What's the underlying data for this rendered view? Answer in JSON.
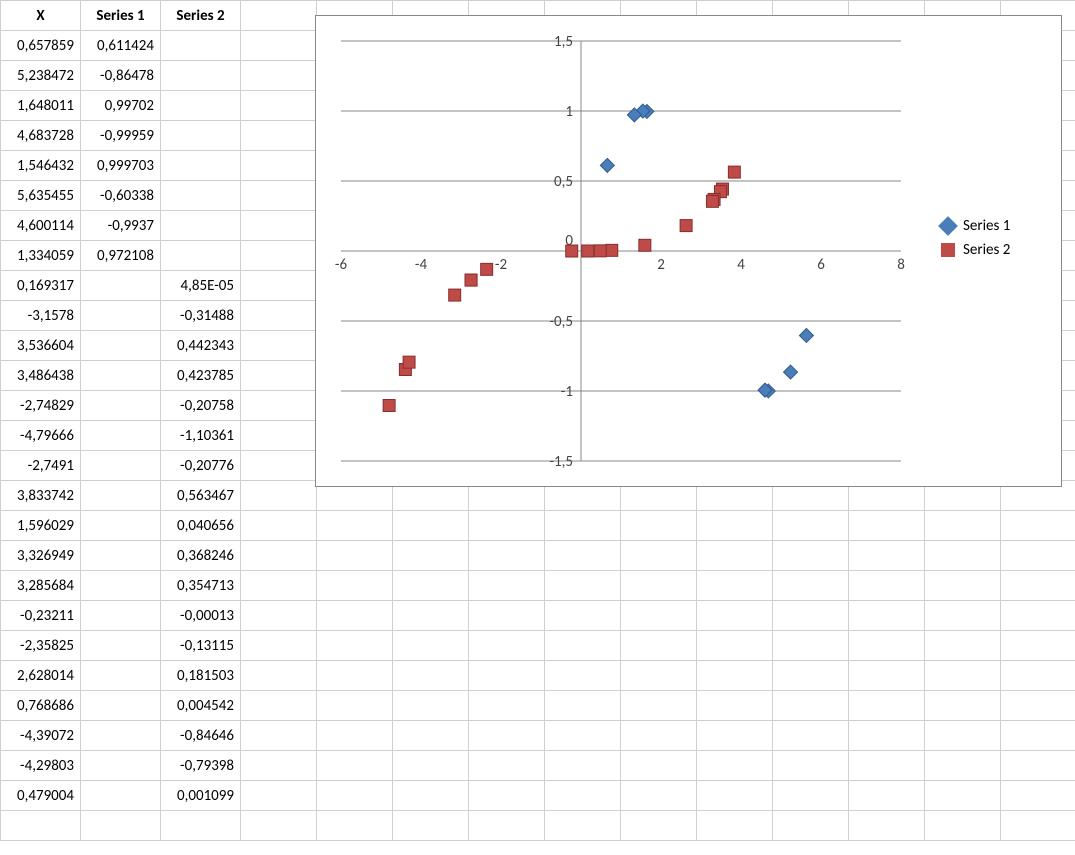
{
  "table": {
    "headers": [
      "X",
      "Series 1",
      "Series 2"
    ],
    "rows": [
      {
        "x": "0,657859",
        "s1": "0,611424",
        "s2": ""
      },
      {
        "x": "5,238472",
        "s1": "-0,86478",
        "s2": ""
      },
      {
        "x": "1,648011",
        "s1": "0,99702",
        "s2": ""
      },
      {
        "x": "4,683728",
        "s1": "-0,99959",
        "s2": ""
      },
      {
        "x": "1,546432",
        "s1": "0,999703",
        "s2": ""
      },
      {
        "x": "5,635455",
        "s1": "-0,60338",
        "s2": ""
      },
      {
        "x": "4,600114",
        "s1": "-0,9937",
        "s2": ""
      },
      {
        "x": "1,334059",
        "s1": "0,972108",
        "s2": ""
      },
      {
        "x": "0,169317",
        "s1": "",
        "s2": "4,85E-05"
      },
      {
        "x": "-3,1578",
        "s1": "",
        "s2": "-0,31488"
      },
      {
        "x": "3,536604",
        "s1": "",
        "s2": "0,442343"
      },
      {
        "x": "3,486438",
        "s1": "",
        "s2": "0,423785"
      },
      {
        "x": "-2,74829",
        "s1": "",
        "s2": "-0,20758"
      },
      {
        "x": "-4,79666",
        "s1": "",
        "s2": "-1,10361"
      },
      {
        "x": "-2,7491",
        "s1": "",
        "s2": "-0,20776"
      },
      {
        "x": "3,833742",
        "s1": "",
        "s2": "0,563467"
      },
      {
        "x": "1,596029",
        "s1": "",
        "s2": "0,040656"
      },
      {
        "x": "3,326949",
        "s1": "",
        "s2": "0,368246"
      },
      {
        "x": "3,285684",
        "s1": "",
        "s2": "0,354713"
      },
      {
        "x": "-0,23211",
        "s1": "",
        "s2": "-0,00013"
      },
      {
        "x": "-2,35825",
        "s1": "",
        "s2": "-0,13115"
      },
      {
        "x": "2,628014",
        "s1": "",
        "s2": "0,181503"
      },
      {
        "x": "0,768686",
        "s1": "",
        "s2": "0,004542"
      },
      {
        "x": "-4,39072",
        "s1": "",
        "s2": "-0,84646"
      },
      {
        "x": "-4,29803",
        "s1": "",
        "s2": "-0,79398"
      },
      {
        "x": "0,479004",
        "s1": "",
        "s2": "0,001099"
      }
    ]
  },
  "legend": {
    "s1": "Series 1",
    "s2": "Series 2"
  },
  "axis": {
    "x": [
      "-6",
      "-4",
      "-2",
      "0",
      "2",
      "4",
      "6",
      "8"
    ],
    "y": [
      "1,5",
      "1",
      "0,5",
      "0",
      "-0,5",
      "-1",
      "-1,5"
    ]
  },
  "chart_data": {
    "type": "scatter",
    "xlim": [
      -6,
      8
    ],
    "ylim": [
      -1.5,
      1.5
    ],
    "xticks": [
      -6,
      -4,
      -2,
      0,
      2,
      4,
      6,
      8
    ],
    "yticks": [
      -1.5,
      -1,
      -0.5,
      0,
      0.5,
      1,
      1.5
    ],
    "series": [
      {
        "name": "Series 1",
        "marker": "diamond",
        "color": "#4a7ebb",
        "points": [
          {
            "x": 0.657859,
            "y": 0.611424
          },
          {
            "x": 5.238472,
            "y": -0.86478
          },
          {
            "x": 1.648011,
            "y": 0.99702
          },
          {
            "x": 4.683728,
            "y": -0.99959
          },
          {
            "x": 1.546432,
            "y": 0.999703
          },
          {
            "x": 5.635455,
            "y": -0.60338
          },
          {
            "x": 4.600114,
            "y": -0.9937
          },
          {
            "x": 1.334059,
            "y": 0.972108
          }
        ]
      },
      {
        "name": "Series 2",
        "marker": "square",
        "color": "#be4b48",
        "points": [
          {
            "x": 0.169317,
            "y": 4.85e-05
          },
          {
            "x": -3.1578,
            "y": -0.31488
          },
          {
            "x": 3.536604,
            "y": 0.442343
          },
          {
            "x": 3.486438,
            "y": 0.423785
          },
          {
            "x": -2.74829,
            "y": -0.20758
          },
          {
            "x": -4.79666,
            "y": -1.10361
          },
          {
            "x": -2.7491,
            "y": -0.20776
          },
          {
            "x": 3.833742,
            "y": 0.563467
          },
          {
            "x": 1.596029,
            "y": 0.040656
          },
          {
            "x": 3.326949,
            "y": 0.368246
          },
          {
            "x": 3.285684,
            "y": 0.354713
          },
          {
            "x": -0.23211,
            "y": -0.00013
          },
          {
            "x": -2.35825,
            "y": -0.13115
          },
          {
            "x": 2.628014,
            "y": 0.181503
          },
          {
            "x": 0.768686,
            "y": 0.004542
          },
          {
            "x": -4.39072,
            "y": -0.84646
          },
          {
            "x": -4.29803,
            "y": -0.79398
          },
          {
            "x": 0.479004,
            "y": 0.001099
          }
        ]
      }
    ]
  },
  "colors": {
    "s1": "#4a7ebb",
    "s2": "#be4b48",
    "grid": "#888"
  }
}
